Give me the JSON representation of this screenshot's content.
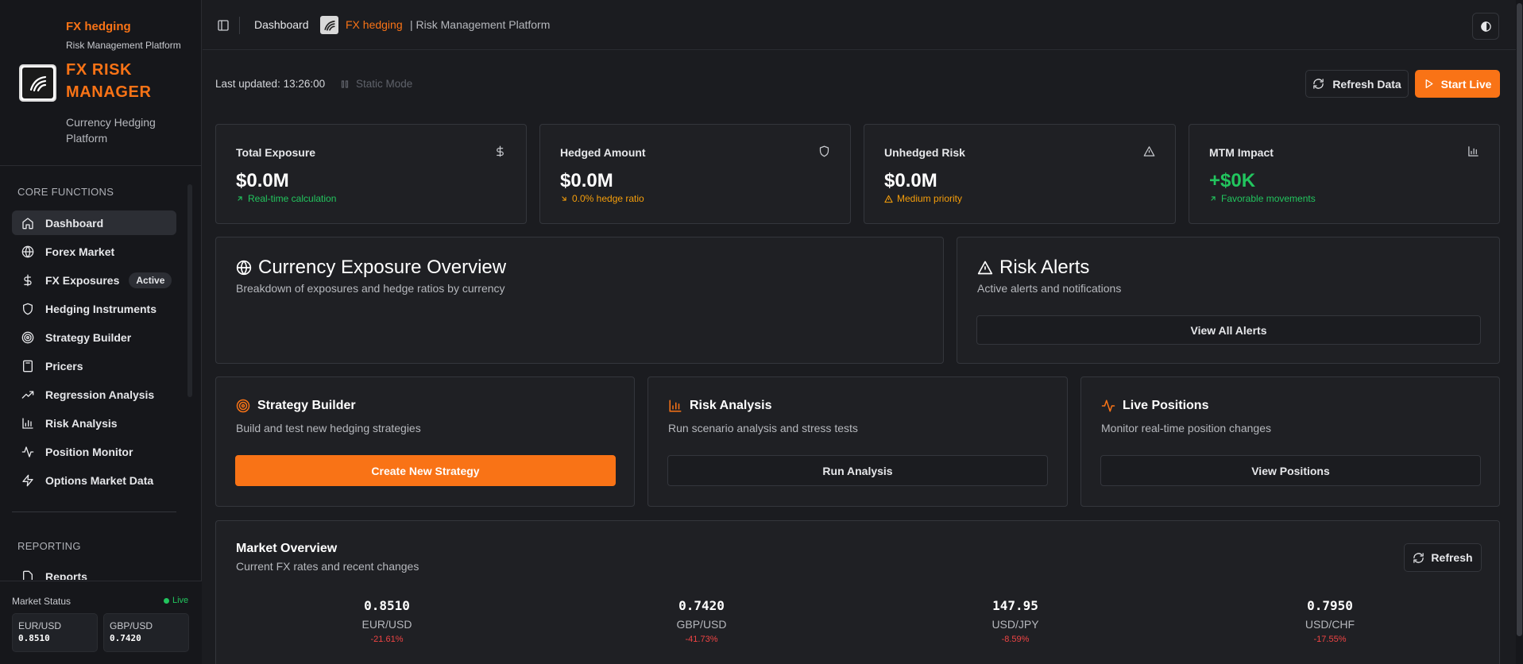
{
  "sidebar": {
    "brand_top": "FX hedging",
    "brand_sub": "Risk Management Platform",
    "title": "FX RISK MANAGER",
    "tagline": "Currency Hedging Platform",
    "section_core": "CORE FUNCTIONS",
    "items": [
      {
        "label": "Dashboard",
        "icon": "home-icon",
        "active": true
      },
      {
        "label": "Forex Market",
        "icon": "globe-icon"
      },
      {
        "label": "FX Exposures",
        "icon": "dollar-icon",
        "badge": "Active"
      },
      {
        "label": "Hedging Instruments",
        "icon": "shield-icon"
      },
      {
        "label": "Strategy Builder",
        "icon": "target-icon"
      },
      {
        "label": "Pricers",
        "icon": "calculator-icon"
      },
      {
        "label": "Regression Analysis",
        "icon": "trending-up-icon"
      },
      {
        "label": "Risk Analysis",
        "icon": "bar-chart-icon"
      },
      {
        "label": "Position Monitor",
        "icon": "activity-icon"
      },
      {
        "label": "Options Market Data",
        "icon": "zap-icon"
      }
    ],
    "section_reporting": "REPORTING",
    "reporting_partial": "Reports",
    "market_status_label": "Market Status",
    "market_live": "Live",
    "rates": [
      {
        "pair": "EUR/USD",
        "value": "0.8510"
      },
      {
        "pair": "GBP/USD",
        "value": "0.7420"
      }
    ]
  },
  "header": {
    "crumb_dashboard": "Dashboard",
    "crumb_fx": "FX hedging",
    "crumb_rest": "| Risk Management Platform"
  },
  "toolbar": {
    "last_updated": "Last updated: 13:26:00",
    "static_mode": "Static Mode",
    "refresh_label": "Refresh Data",
    "start_live_label": "Start Live"
  },
  "kpis": [
    {
      "title": "Total Exposure",
      "icon": "dollar-icon",
      "value": "$0.0M",
      "sub": "Real-time calculation",
      "sub_icon": "arrow-up-right-icon",
      "sub_color": "#22c55e",
      "value_color": "#ffffff"
    },
    {
      "title": "Hedged Amount",
      "icon": "shield-icon",
      "value": "$0.0M",
      "sub": "0.0% hedge ratio",
      "sub_icon": "arrow-down-right-icon",
      "sub_color": "#f59e0b",
      "value_color": "#ffffff"
    },
    {
      "title": "Unhedged Risk",
      "icon": "alert-triangle-icon",
      "value": "$0.0M",
      "sub": "Medium priority",
      "sub_icon": "alert-triangle-icon",
      "sub_color": "#f59e0b",
      "value_color": "#ffffff"
    },
    {
      "title": "MTM Impact",
      "icon": "bar-chart-icon",
      "value": "+$0K",
      "sub": "Favorable movements",
      "sub_icon": "arrow-up-right-icon",
      "sub_color": "#22c55e",
      "value_color": "#22c55e"
    }
  ],
  "exposure": {
    "title": "Currency Exposure Overview",
    "desc": "Breakdown of exposures and hedge ratios by currency"
  },
  "alerts": {
    "title": "Risk Alerts",
    "desc": "Active alerts and notifications",
    "button": "View All Alerts"
  },
  "actions": [
    {
      "title": "Strategy Builder",
      "icon": "target-icon",
      "desc": "Build and test new hedging strategies",
      "button": "Create New Strategy",
      "primary": true
    },
    {
      "title": "Risk Analysis",
      "icon": "bar-chart-icon",
      "desc": "Run scenario analysis and stress tests",
      "button": "Run Analysis",
      "primary": false
    },
    {
      "title": "Live Positions",
      "icon": "activity-icon",
      "desc": "Monitor real-time position changes",
      "button": "View Positions",
      "primary": false
    }
  ],
  "market_overview": {
    "title": "Market Overview",
    "desc": "Current FX rates and recent changes",
    "refresh": "Refresh",
    "rates": [
      {
        "value": "0.8510",
        "pair": "EUR/USD",
        "change": "-21.61%"
      },
      {
        "value": "0.7420",
        "pair": "GBP/USD",
        "change": "-41.73%"
      },
      {
        "value": "147.95",
        "pair": "USD/JPY",
        "change": "-8.59%"
      },
      {
        "value": "0.7950",
        "pair": "USD/CHF",
        "change": "-17.55%"
      }
    ]
  },
  "colors": {
    "accent": "#f97316",
    "positive": "#22c55e",
    "warning": "#f59e0b",
    "negative": "#ef4444",
    "background": "#1b1c20",
    "card": "#1f2024"
  }
}
